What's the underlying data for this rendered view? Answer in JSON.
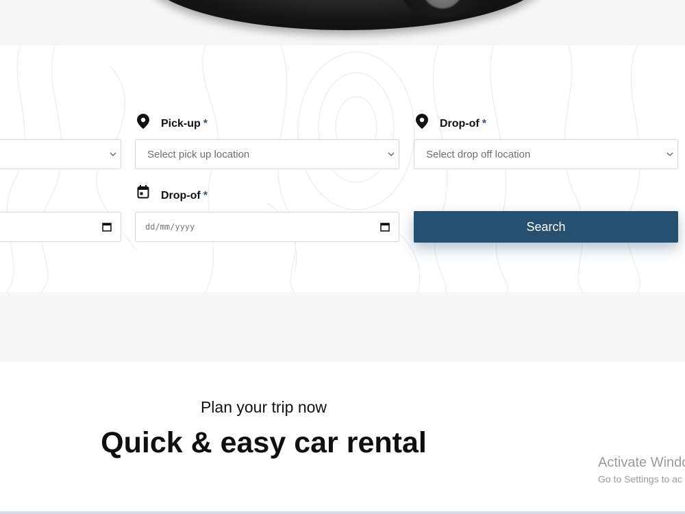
{
  "form": {
    "pickup_location": {
      "label": "Pick-up",
      "required_mark": "*",
      "placeholder": "Select pick up location",
      "icon": "location-pin-icon"
    },
    "dropoff_location": {
      "label": "Drop-of",
      "required_mark": "*",
      "placeholder": "Select drop off location",
      "icon": "location-pin-icon"
    },
    "dropoff_date": {
      "label": "Drop-of",
      "required_mark": "*",
      "placeholder": "dd/mm/yyyy",
      "icon": "calendar-icon"
    },
    "search_button": "Search"
  },
  "section": {
    "subtitle": "Plan your trip now",
    "headline": "Quick & easy car rental"
  },
  "watermark": {
    "line1": "Activate Windo",
    "line2": "Go to Settings to ac"
  },
  "colors": {
    "accent": "#26506f",
    "required": "#2b5378"
  }
}
